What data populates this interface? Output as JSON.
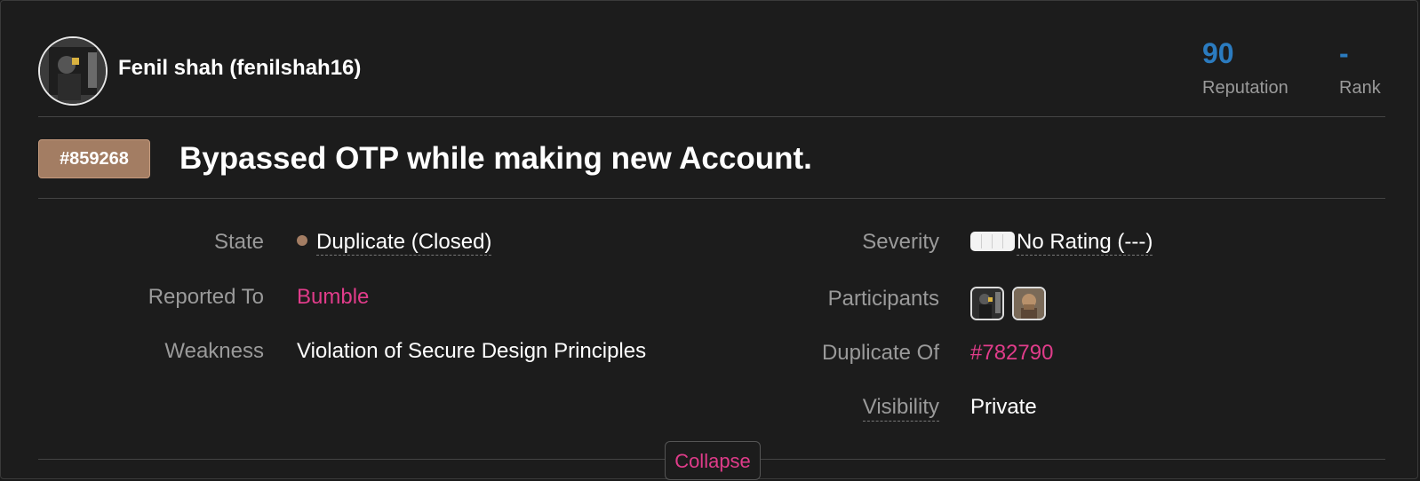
{
  "reporter": {
    "name": "Fenil shah (fenilshah16)"
  },
  "stats": {
    "reputation_value": "90",
    "reputation_label": "Reputation",
    "rank_value": "-",
    "rank_label": "Rank"
  },
  "report": {
    "id": "#859268",
    "title": "Bypassed OTP while making new Account."
  },
  "meta": {
    "state_label": "State",
    "state_value": "Duplicate (Closed)",
    "reported_to_label": "Reported To",
    "reported_to_value": "Bumble",
    "weakness_label": "Weakness",
    "weakness_value": "Violation of Secure Design Principles",
    "severity_label": "Severity",
    "severity_value": "No Rating (---)",
    "participants_label": "Participants",
    "duplicate_of_label": "Duplicate Of",
    "duplicate_of_value": "#782790",
    "visibility_label": "Visibility",
    "visibility_value": "Private"
  },
  "actions": {
    "collapse_label": "Collapse"
  },
  "colors": {
    "accent_link": "#e03c8a",
    "stat_blue": "#2b7bbf",
    "badge_tan": "#a37d63"
  },
  "icons": [
    "reporter-avatar",
    "state-dot-icon",
    "severity-bar-icon",
    "participant-avatar"
  ]
}
